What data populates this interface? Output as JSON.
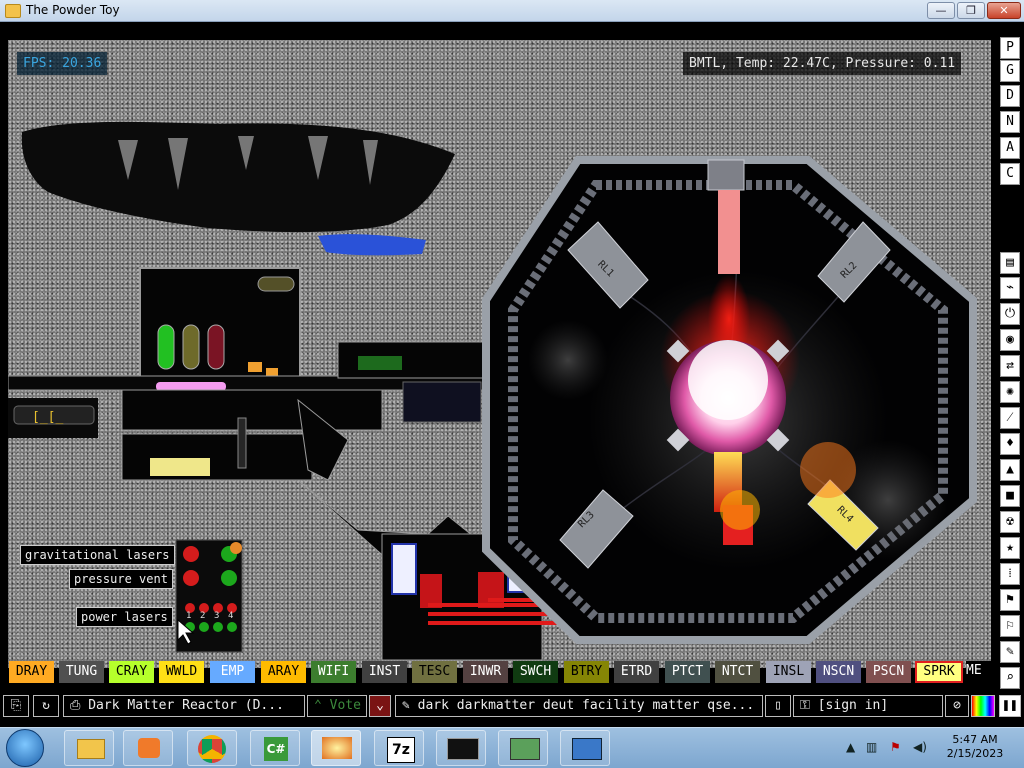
{
  "window": {
    "title": "The Powder Toy",
    "min_glyph": "—",
    "max_glyph": "❐",
    "close_glyph": "✕"
  },
  "hud": {
    "fps": "FPS: 20.36",
    "info": "BMTL, Temp: 22.47C, Pressure: 0.11"
  },
  "right_menu": {
    "letters": [
      "P",
      "G",
      "D",
      "N",
      "A",
      "C"
    ],
    "categories": [
      "walls",
      "electronics",
      "powered",
      "sensors",
      "force",
      "explosives",
      "gas",
      "liquids",
      "powders",
      "solids",
      "radioactive",
      "special",
      "life",
      "tools",
      "favorites",
      "decoration",
      "search",
      "pause"
    ]
  },
  "labels": {
    "gravitational_lasers": "gravitational lasers",
    "pressure_vent": "pressure vent",
    "power_lasers": "power lasers",
    "switch_numbers": [
      "1",
      "2",
      "3",
      "4"
    ]
  },
  "elements": [
    {
      "name": "DRAY",
      "bg": "#ffaa22",
      "fg": "#000000"
    },
    {
      "name": "TUNG",
      "bg": "#505050",
      "fg": "#ffffff"
    },
    {
      "name": "CRAY",
      "bg": "#b6ff2b",
      "fg": "#000000"
    },
    {
      "name": "WWLD",
      "bg": "#ffdf16",
      "fg": "#000000"
    },
    {
      "name": "EMP",
      "bg": "#66aaff",
      "fg": "#ffffff"
    },
    {
      "name": "ARAY",
      "bg": "#ffbb00",
      "fg": "#000000"
    },
    {
      "name": "WIFI",
      "bg": "#3c7d2e",
      "fg": "#ffffff"
    },
    {
      "name": "INST",
      "bg": "#404040",
      "fg": "#ffffff"
    },
    {
      "name": "TESC",
      "bg": "#707040",
      "fg": "#000000"
    },
    {
      "name": "INWR",
      "bg": "#544141",
      "fg": "#ffffff"
    },
    {
      "name": "SWCH",
      "bg": "#103b11",
      "fg": "#ffffff"
    },
    {
      "name": "BTRY",
      "bg": "#858505",
      "fg": "#000000"
    },
    {
      "name": "ETRD",
      "bg": "#404040",
      "fg": "#ffffff"
    },
    {
      "name": "PTCT",
      "bg": "#405050",
      "fg": "#ffffff"
    },
    {
      "name": "NTCT",
      "bg": "#505040",
      "fg": "#ffffff"
    },
    {
      "name": "INSL",
      "bg": "#9ea3b6",
      "fg": "#000000"
    },
    {
      "name": "NSCN",
      "bg": "#505080",
      "fg": "#ffffff"
    },
    {
      "name": "PSCN",
      "bg": "#805050",
      "fg": "#ffffff"
    },
    {
      "name": "SPRK",
      "bg": "#ffff80",
      "fg": "#000000",
      "selected": true
    },
    {
      "name": "ME",
      "bg": "#000000",
      "fg": "#ffffff"
    }
  ],
  "toolbar": {
    "save_title": "Dark Matter Reactor (D...",
    "vote": "Vote",
    "tags": "dark darkmatter deut facility matter qse...",
    "sign_in": "[sign in]"
  },
  "taskbar": {
    "apps": [
      "explorer",
      "media-player",
      "chrome",
      "csharp-editor",
      "powder-toy",
      "7zip",
      "command-prompt",
      "computer",
      "control-panel"
    ],
    "app_7z_label": "7z",
    "time": "5:47 AM",
    "date": "2/15/2023"
  }
}
